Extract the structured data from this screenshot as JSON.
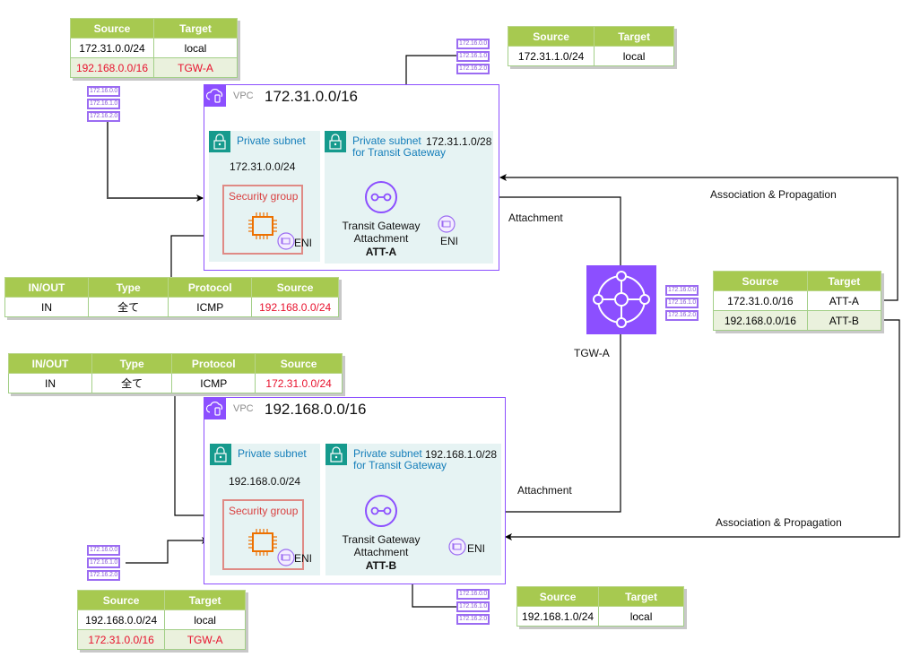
{
  "route_tables": {
    "vpc_a_private": {
      "headers": [
        "Source",
        "Target"
      ],
      "rows": [
        {
          "source": "172.31.0.0/24",
          "target": "local",
          "highlight": false
        },
        {
          "source": "192.168.0.0/16",
          "target": "TGW-A",
          "highlight": true
        }
      ]
    },
    "vpc_a_tgw": {
      "headers": [
        "Source",
        "Target"
      ],
      "rows": [
        {
          "source": "172.31.1.0/24",
          "target": "local",
          "highlight": false
        }
      ]
    },
    "tgw": {
      "headers": [
        "Source",
        "Target"
      ],
      "rows": [
        {
          "source": "172.31.0.0/16",
          "target": "ATT-A"
        },
        {
          "source": "192.168.0.0/16",
          "target": "ATT-B"
        }
      ]
    },
    "vpc_b_private": {
      "headers": [
        "Source",
        "Target"
      ],
      "rows": [
        {
          "source": "192.168.0.0/24",
          "target": "local",
          "highlight": false
        },
        {
          "source": "172.31.0.0/16",
          "target": "TGW-A",
          "highlight": true
        }
      ]
    },
    "vpc_b_tgw": {
      "headers": [
        "Source",
        "Target"
      ],
      "rows": [
        {
          "source": "192.168.1.0/24",
          "target": "local",
          "highlight": false
        }
      ]
    }
  },
  "security_group_rules": {
    "vpc_a": {
      "headers": [
        "IN/OUT",
        "Type",
        "Protocol",
        "Source"
      ],
      "rows": [
        {
          "direction": "IN",
          "type": "全て",
          "protocol": "ICMP",
          "source": "192.168.0.0/24"
        }
      ]
    },
    "vpc_b": {
      "headers": [
        "IN/OUT",
        "Type",
        "Protocol",
        "Source"
      ],
      "rows": [
        {
          "direction": "IN",
          "type": "全て",
          "protocol": "ICMP",
          "source": "172.31.0.0/24"
        }
      ]
    }
  },
  "route_table_icon_entries": [
    "172.16.0.0",
    "172.16.1.0",
    "172.16.2.0"
  ],
  "vpcs": {
    "a": {
      "label": "VPC",
      "cidr": "172.31.0.0/16",
      "private_subnet": {
        "title": "Private subnet",
        "cidr": "172.31.0.0/24"
      },
      "security_group": "Security group",
      "eni_label": "ENI",
      "tgw_subnet": {
        "title_line1": "Private subnet",
        "title_line2": "for Transit Gateway",
        "cidr": "172.31.1.0/28"
      },
      "attachment": {
        "line1": "Transit Gateway",
        "line2": "Attachment",
        "name": "ATT-A"
      }
    },
    "b": {
      "label": "VPC",
      "cidr": "192.168.0.0/16",
      "private_subnet": {
        "title": "Private subnet",
        "cidr": "192.168.0.0/24"
      },
      "security_group": "Security group",
      "eni_label": "ENI",
      "tgw_subnet": {
        "title_line1": "Private subnet",
        "title_line2": "for Transit Gateway",
        "cidr": "192.168.1.0/28"
      },
      "attachment": {
        "line1": "Transit Gateway",
        "line2": "Attachment",
        "name": "ATT-B"
      }
    }
  },
  "tgw": {
    "name": "TGW-A"
  },
  "edge_labels": {
    "attachment_a": "Attachment",
    "attachment_b": "Attachment",
    "assoc_a": "Association & Propagation",
    "assoc_b": "Association & Propagation"
  },
  "colors": {
    "table_header": "#a7c950",
    "vpc_border": "#8c4fff",
    "subnet_bg": "#e6f3f3",
    "lock": "#169a8d",
    "security_group": "#df8a85",
    "ec2": "#ed7100",
    "tgw": "#8c4fff",
    "highlight_text": "#e8112d"
  }
}
